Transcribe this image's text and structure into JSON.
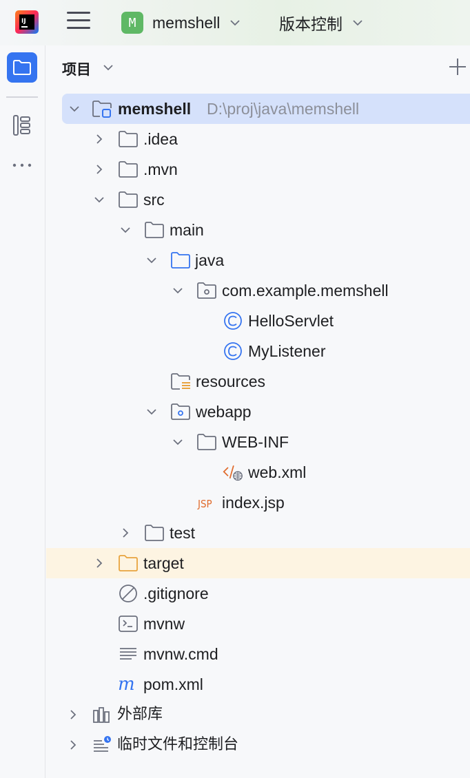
{
  "topbar": {
    "project_badge": "M",
    "project_name": "memshell",
    "vcs_label": "版本控制"
  },
  "panel": {
    "title": "项目"
  },
  "tree": {
    "root": {
      "label": "memshell",
      "path": "D:\\proj\\java\\memshell"
    },
    "idea": "idea",
    "mvn": "mvn",
    "items": {
      "idea": ".idea",
      "mvn": ".mvn",
      "src": "src",
      "main": "main",
      "java": "java",
      "package": "com.example.memshell",
      "hello_servlet": "HelloServlet",
      "my_listener": "MyListener",
      "resources": "resources",
      "webapp": "webapp",
      "web_inf": "WEB-INF",
      "web_xml": "web.xml",
      "index_jsp": "index.jsp",
      "test": "test",
      "target": "target",
      "gitignore": ".gitignore",
      "mvnw": "mvnw",
      "mvnw_cmd": "mvnw.cmd",
      "pom_xml": "pom.xml",
      "external_libs": "外部库",
      "scratches": "临时文件和控制台"
    }
  },
  "colors": {
    "accent": "#3574f0",
    "selected_row": "#d5e1fb",
    "highlight_row": "#fdf4e2",
    "project_badge": "#5fb865",
    "excluded_folder": "#e8a33e",
    "xml_icon": "#e06b2c"
  }
}
